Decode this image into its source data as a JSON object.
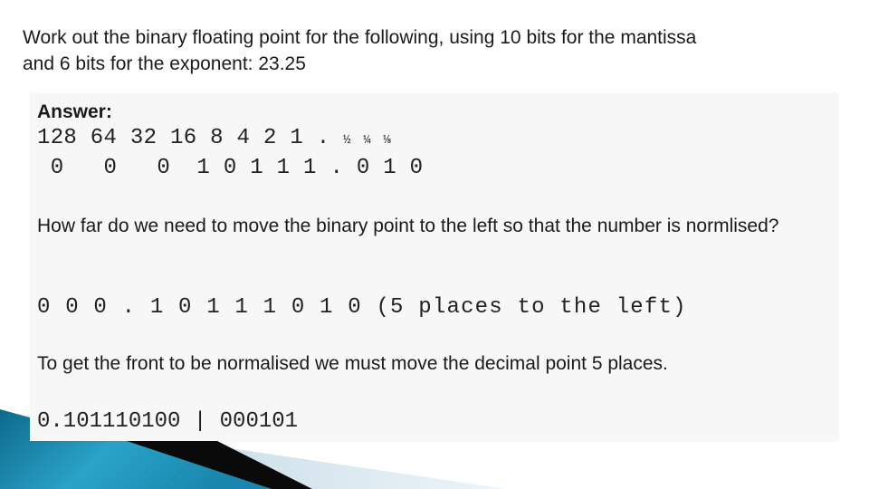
{
  "slide": {
    "title_line1": "Work out the binary floating point for the following, using 10 bits for the mantissa",
    "title_line2": "and 6 bits for the exponent:  23.25",
    "answer_label": "Answer:",
    "place_values": {
      "integer": "128 64 32 16 8 4 2 1 . ",
      "fractions": [
        "½",
        "¼",
        "⅛"
      ]
    },
    "bits_row": " 0   0   0  1 0 1 1 1 . 0 1 0",
    "question": "How far do we need to move the binary point to the left so that the number is normlised?",
    "normalised_shift": "0 0 0 . 1 0 1 1 1 0 1 0 (5 places to the left)",
    "explanation": "To get the front to be normalised we must move the decimal point 5 places.",
    "result": "0.101110100 | 000101"
  },
  "theme": {
    "swoosh_blue": "#1e8fb3",
    "swoosh_dark_blue": "#0d6a8c",
    "swoosh_black": "#0a0a0a",
    "swoosh_light": "#d6e6ee",
    "box_background": "#f7f7f7"
  }
}
